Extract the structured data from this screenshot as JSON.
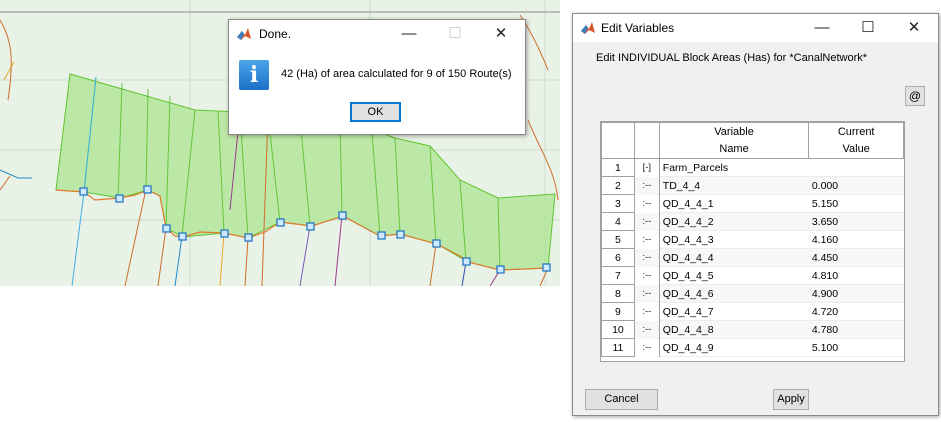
{
  "done_dialog": {
    "title": "Done.",
    "message": "42 (Ha) of area calculated for 9 of 150 Route(s)",
    "ok_label": "OK",
    "minimize_glyph": "—",
    "maximize_glyph": "☐",
    "close_glyph": "✕",
    "icon": "info-icon",
    "icon_glyph": "i"
  },
  "edit_dialog": {
    "title": "Edit Variables",
    "subtitle": "Edit INDIVIDUAL Block Areas (Has) for *CanalNetwork*",
    "at_button": "@",
    "minimize_glyph": "—",
    "maximize_glyph": "☐",
    "close_glyph": "✕",
    "columns": {
      "name_line1": "Variable",
      "name_line2": "Name",
      "value_line1": "Current",
      "value_line2": "Value"
    },
    "rows": [
      {
        "num": "1",
        "tree": "[-]",
        "name": "Farm_Parcels",
        "value": ""
      },
      {
        "num": "2",
        "tree": ":--",
        "name": "TD_4_4",
        "value": "0.000"
      },
      {
        "num": "3",
        "tree": ":--",
        "name": "QD_4_4_1",
        "value": "5.150"
      },
      {
        "num": "4",
        "tree": ":--",
        "name": "QD_4_4_2",
        "value": "3.650"
      },
      {
        "num": "5",
        "tree": ":--",
        "name": "QD_4_4_3",
        "value": "4.160"
      },
      {
        "num": "6",
        "tree": ":--",
        "name": "QD_4_4_4",
        "value": "4.450"
      },
      {
        "num": "7",
        "tree": ":--",
        "name": "QD_4_4_5",
        "value": "4.810"
      },
      {
        "num": "8",
        "tree": ":--",
        "name": "QD_4_4_6",
        "value": "4.900"
      },
      {
        "num": "9",
        "tree": ":--",
        "name": "QD_4_4_7",
        "value": "4.720"
      },
      {
        "num": "10",
        "tree": ":--",
        "name": "QD_4_4_8",
        "value": "4.780"
      },
      {
        "num": "11",
        "tree": ":--",
        "name": "QD_4_4_9",
        "value": "5.100"
      }
    ],
    "cancel_label": "Cancel",
    "apply_label": "Apply"
  },
  "colors": {
    "map_bg": "#e9f2e7",
    "parcel_fill": "#9fe07a",
    "parcel_stroke": "#5ec42c",
    "canal": "#e07a2e",
    "node": "#1b7fd1"
  }
}
